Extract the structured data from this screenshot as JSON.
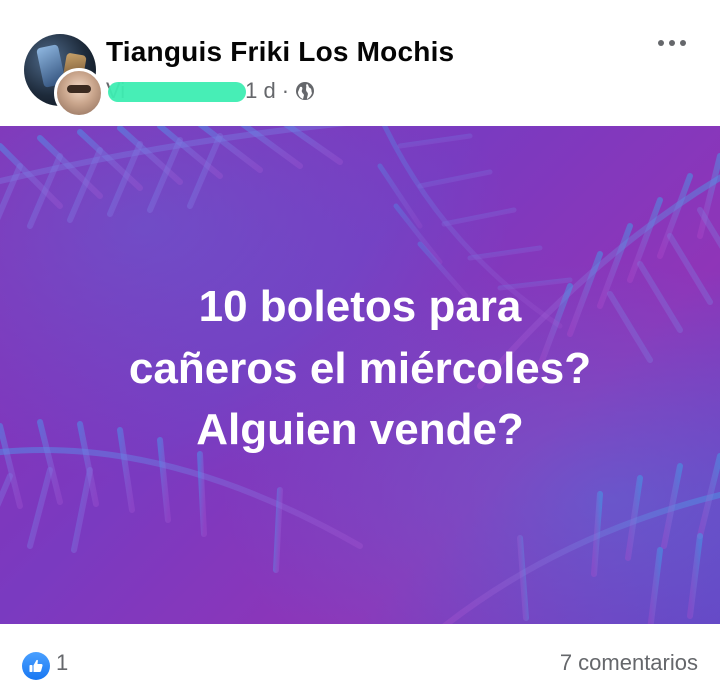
{
  "header": {
    "page_name": "Tianguis Friki Los Mochis",
    "author_visible": "Vi",
    "time": "1 d",
    "separator": "·",
    "audience_icon": "globe-icon",
    "more_icon": "more-options-icon"
  },
  "post": {
    "lines": [
      "10 boletos para",
      "cañeros el miércoles?",
      "Alguien vende?"
    ],
    "text_color": "#ffffff",
    "background_colors": [
      "#8a2fb5",
      "#6c3fc2",
      "#3f7fd8"
    ]
  },
  "footer": {
    "like_icon": "like-icon",
    "reaction_count": "1",
    "comments": "7 comentarios",
    "like_color": "#1877f2"
  },
  "redaction_color": "#3dedb2"
}
